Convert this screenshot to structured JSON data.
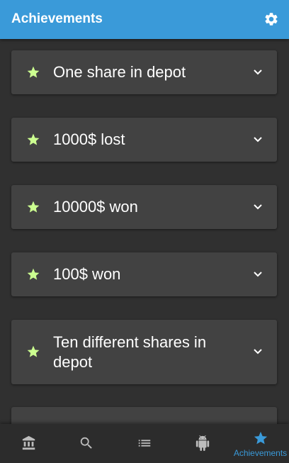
{
  "header": {
    "title": "Achievements",
    "settings_icon": "gear-icon",
    "background": "#3a9ad9"
  },
  "achievements": [
    {
      "label": "One share in depot",
      "icon": "star-icon"
    },
    {
      "label": "1000$ lost",
      "icon": "star-icon"
    },
    {
      "label": "10000$ won",
      "icon": "star-icon"
    },
    {
      "label": "100$ won",
      "icon": "star-icon"
    },
    {
      "label": "Ten different shares in depot",
      "icon": "star-icon"
    }
  ],
  "star_color": "#ccff90",
  "bottom_nav": {
    "items": [
      {
        "icon": "bank-icon",
        "label": ""
      },
      {
        "icon": "search-icon",
        "label": ""
      },
      {
        "icon": "list-icon",
        "label": ""
      },
      {
        "icon": "android-icon",
        "label": ""
      },
      {
        "icon": "star-icon",
        "label": "Achievements",
        "active": true
      }
    ],
    "active_color": "#3a9ad9",
    "inactive_color": "#bdbdbd"
  }
}
